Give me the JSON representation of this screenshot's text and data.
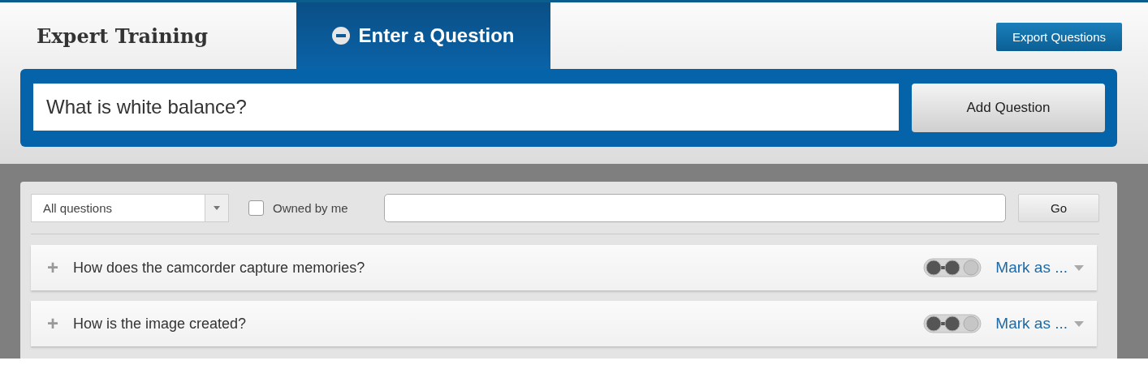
{
  "header": {
    "title": "Expert Training",
    "tab": {
      "label": "Enter a Question",
      "selected": true
    },
    "export_button": "Export Questions"
  },
  "question_entry": {
    "value": "What is white balance?",
    "button": "Add Question"
  },
  "filters": {
    "dropdown": "All questions",
    "owned_by_me": {
      "label": "Owned by me",
      "checked": false
    },
    "go_button": "Go"
  },
  "questions": [
    {
      "expand": "+",
      "text": "How does the camcorder capture memories?",
      "mark": "Mark as ..."
    },
    {
      "expand": "+",
      "text": "How is the image created?",
      "mark": "Mark as ..."
    }
  ]
}
